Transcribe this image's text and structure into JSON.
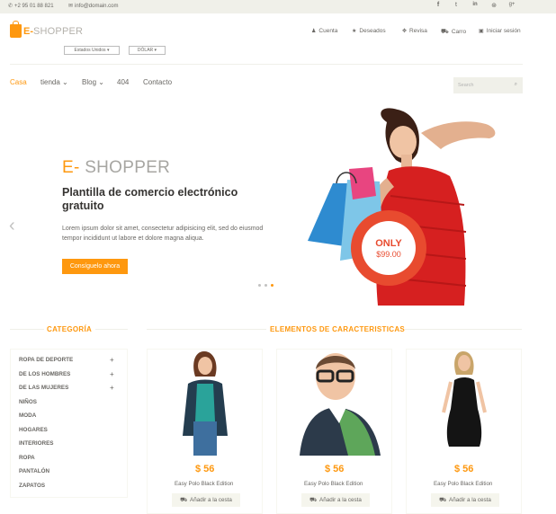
{
  "topbar": {
    "phone": "+2 95 01 88 821",
    "email": "info@domain.com",
    "social_icons": [
      "facebook-icon",
      "twitter-icon",
      "linkedin-icon",
      "dribbble-icon",
      "google-plus-icon"
    ],
    "social_glyphs": [
      "f",
      "t",
      "in",
      "⊛",
      "g+"
    ]
  },
  "logo": {
    "e": "E-",
    "rest": "SHOPPER"
  },
  "dropdowns": {
    "country": "Estados Unidos ▾",
    "currency": "DÓLAR ▾"
  },
  "account_menu": [
    {
      "label": "Cuenta",
      "icon": "user-icon",
      "glyph": "♟"
    },
    {
      "label": "Deseados",
      "icon": "star-icon",
      "glyph": "★"
    },
    {
      "label": "Revisa",
      "icon": "crosshairs-icon",
      "glyph": "✥"
    },
    {
      "label": "Carro",
      "icon": "cart-icon",
      "glyph": "🛒"
    },
    {
      "label": "Iniciar sesión",
      "icon": "lock-icon",
      "glyph": "🔒"
    }
  ],
  "nav": [
    {
      "label": "Casa",
      "active": true
    },
    {
      "label": "tienda ⌄"
    },
    {
      "label": "Blog ⌄"
    },
    {
      "label": "404"
    },
    {
      "label": "Contacto"
    }
  ],
  "search": {
    "placeholder": "Search"
  },
  "hero": {
    "brand_e": "E-",
    "brand_rest": " SHOPPER",
    "title": "Plantilla de comercio electrónico gratuito",
    "text": "Lorem ipsum dolor sit amet, consectetur adipisicing elit, sed do eiusmod tempor incididunt ut labore et dolore magna aliqua.",
    "button": "Consíguelo ahora",
    "badge_only": "ONLY",
    "badge_price": "$99.00",
    "slides_total": 3,
    "active_slide": 3
  },
  "category": {
    "title": "CATEGORÍA",
    "items": [
      {
        "label": "ROPA DE DEPORTE",
        "expandable": true
      },
      {
        "label": "DE LOS HOMBRES",
        "expandable": true
      },
      {
        "label": "DE LAS MUJERES",
        "expandable": true
      },
      {
        "label": "NIÑOS"
      },
      {
        "label": "MODA"
      },
      {
        "label": "HOGARES"
      },
      {
        "label": "INTERIORES"
      },
      {
        "label": "ROPA"
      },
      {
        "label": "PANTALÓN"
      },
      {
        "label": "ZAPATOS"
      }
    ]
  },
  "features": {
    "title": "ELEMENTOS DE CARACTERISTICAS",
    "products": [
      {
        "price": "$ 56",
        "name": "Easy Polo Black Edition",
        "button": "Añadir a la cesta"
      },
      {
        "price": "$ 56",
        "name": "Easy Polo Black Edition",
        "button": "Añadir a la cesta"
      },
      {
        "price": "$ 56",
        "name": "Easy Polo Black Edition",
        "button": "Añadir a la cesta"
      }
    ]
  },
  "colors": {
    "accent": "#FE980F",
    "text": "#696763",
    "topbar": "#F0F0E9",
    "dress_red": "#D62020"
  }
}
